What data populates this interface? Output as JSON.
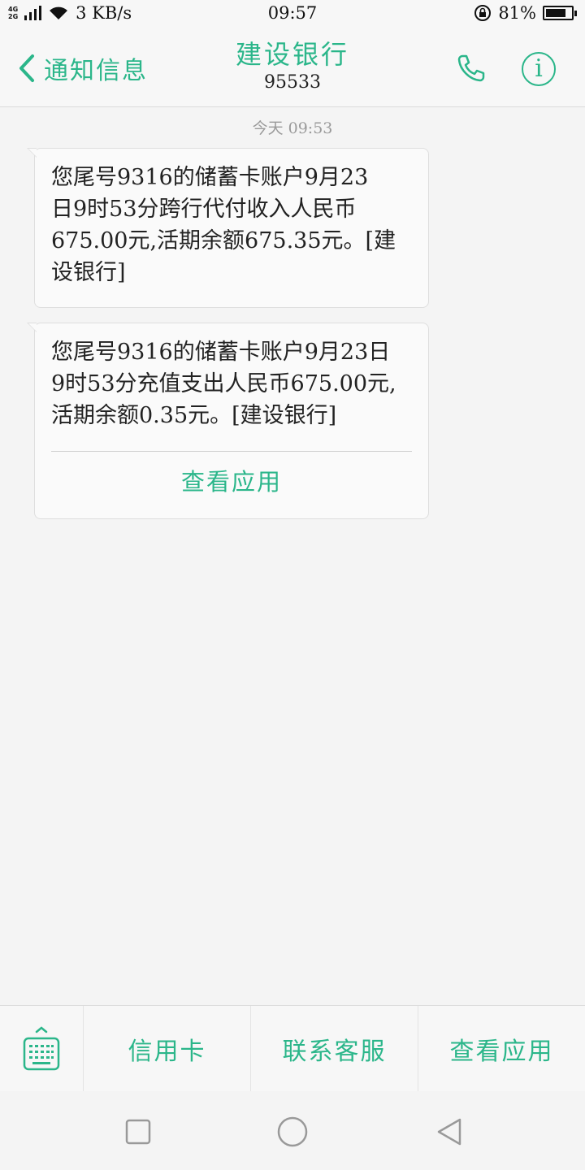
{
  "status_bar": {
    "network_top": "4G",
    "network_bottom": "2G",
    "speed": "3 KB/s",
    "time": "09:57",
    "battery": "81%",
    "battery_level": 0.81
  },
  "header": {
    "back_label": "通知信息",
    "title": "建设银行",
    "number": "95533",
    "accent_color": "#2bb68a"
  },
  "conversation": {
    "timestamp": "今天 09:53",
    "messages": [
      {
        "lines": [
          "您尾号9316的储蓄卡账户9月23",
          "日9时53分跨行代付收入人民币",
          "675.00元,活期余额675.35元。[建",
          "设银行]"
        ]
      },
      {
        "lines": [
          "您尾号9316的储蓄卡账户9月23日",
          "9时53分充值支出人民币675.00元,",
          "活期余额0.35元。[建设银行]"
        ],
        "action": "查看应用"
      }
    ]
  },
  "menu": {
    "items": [
      "信用卡",
      "联系客服",
      "查看应用"
    ]
  },
  "icons": {
    "back": "chevron-left-icon",
    "call": "phone-icon",
    "info": "info-icon",
    "keyboard": "keyboard-icon",
    "recents": "square-icon",
    "home": "circle-icon",
    "back_nav": "triangle-left-icon"
  }
}
